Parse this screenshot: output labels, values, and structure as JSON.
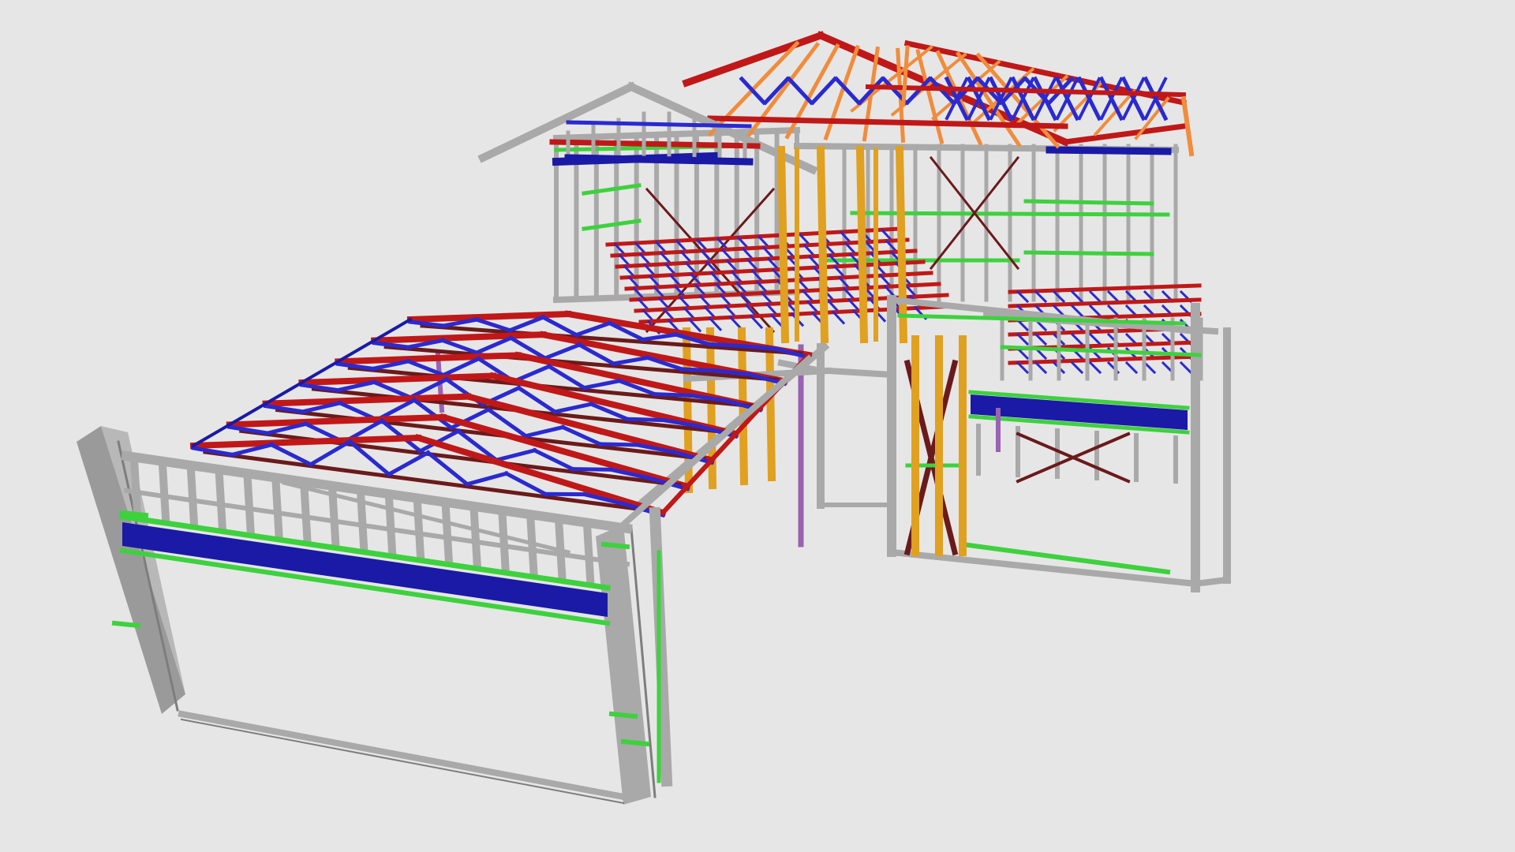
{
  "scene": {
    "description_visible_text": "",
    "colors": {
      "background": "#e6e6e6",
      "wall_frame": "#a9a9a9",
      "wall_frame_edge": "#7d7d7d",
      "nogging": "#3ed13e",
      "lintel": "#1a1aa6",
      "truss_chord": "#c01818",
      "truss_web": "#2a2ad0",
      "brace": "#6a1a1a",
      "post": "#e0a020",
      "rafter": "#f08c3c",
      "purple_post": "#9a62b0"
    },
    "components": [
      "garage-wall-frame",
      "garage-roof-trusses",
      "upper-floor-wall-frames",
      "main-roof-trusses",
      "gable-roof",
      "floor-joists",
      "right-wing-wall-frames",
      "cross-bracing",
      "support-posts"
    ]
  }
}
